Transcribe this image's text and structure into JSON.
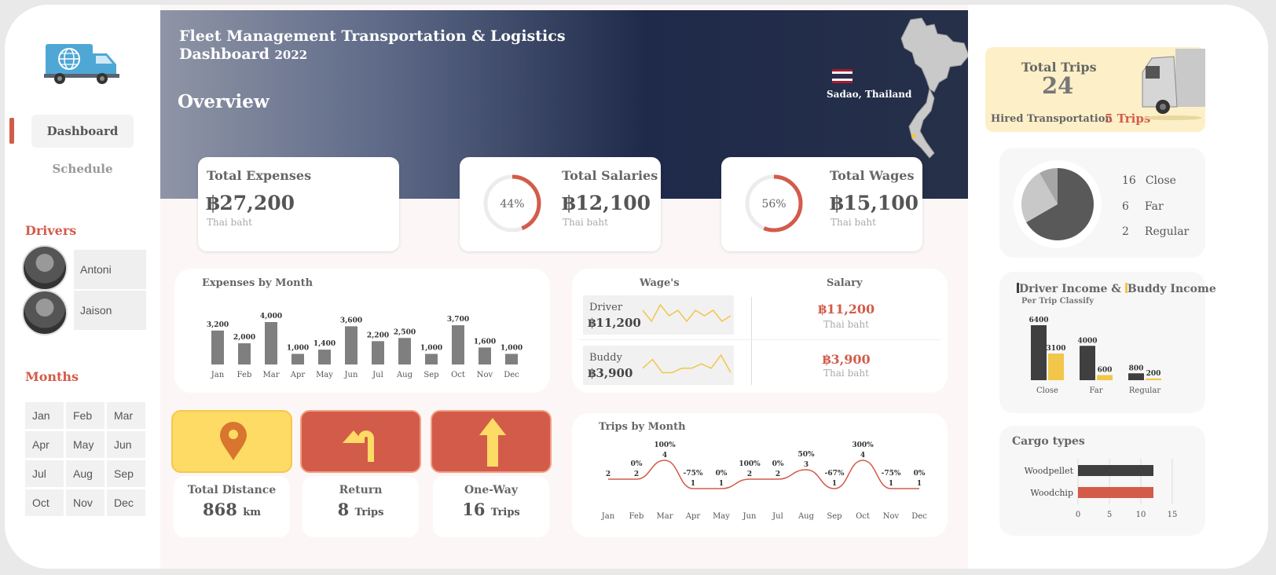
{
  "sidebar": {
    "nav": [
      {
        "label": "Dashboard"
      },
      {
        "label": "Schedule"
      }
    ],
    "drivers_title": "Drivers",
    "drivers": [
      {
        "name": "Antoni"
      },
      {
        "name": "Jaison"
      }
    ],
    "months_title": "Months",
    "months": [
      "Jan",
      "Feb",
      "Mar",
      "Apr",
      "May",
      "Jun",
      "Jul",
      "Aug",
      "Sep",
      "Oct",
      "Nov",
      "Dec"
    ]
  },
  "header": {
    "title_line1": "Fleet Management Transportation & Logistics",
    "title_line2": "Dashboard",
    "year": "2022",
    "overview": "Overview",
    "location": "Sadao, Thailand"
  },
  "kpis": {
    "expenses": {
      "label": "Total Expenses",
      "value": "฿27,200",
      "unit": "Thai baht"
    },
    "salaries": {
      "label": "Total Salaries",
      "value": "฿12,100",
      "unit": "Thai baht",
      "pct_label": "44%",
      "pct": 0.44
    },
    "wages": {
      "label": "Total Wages",
      "value": "฿15,100",
      "unit": "Thai baht",
      "pct_label": "56%",
      "pct": 0.56
    }
  },
  "tiles": {
    "distance": {
      "label": "Total Distance",
      "value": "868",
      "unit": "km"
    },
    "return": {
      "label": "Return",
      "value": "8",
      "unit": "Trips"
    },
    "oneway": {
      "label": "One-Way",
      "value": "16",
      "unit": "Trips"
    }
  },
  "wage_panel": {
    "wages_title": "Wage's",
    "salary_title": "Salary",
    "rows": [
      {
        "name": "Driver",
        "value": "฿11,200",
        "salary": "฿11,200",
        "salary_unit": "Thai baht",
        "spark": [
          3,
          1,
          4,
          2,
          3,
          1,
          3,
          2,
          3,
          1,
          2
        ]
      },
      {
        "name": "Buddy",
        "value": "฿3,900",
        "salary": "฿3,900",
        "salary_unit": "Thai baht",
        "spark": [
          2,
          4,
          1,
          1,
          2,
          2,
          3,
          2,
          5,
          1
        ]
      }
    ]
  },
  "right": {
    "total_trips_label": "Total Trips",
    "total_trips_value": "24",
    "hired_label": "Hired  Transportation",
    "hired_value": "5 Trips",
    "distance_legend": [
      {
        "count": "16",
        "label": "Close",
        "value": 16
      },
      {
        "count": "6",
        "label": "Far",
        "value": 6
      },
      {
        "count": "2",
        "label": "Regular",
        "value": 2
      }
    ],
    "income_title_a": "Driver Income &",
    "income_title_b": "Buddy Income",
    "income_subtitle": "Per Trip Classify",
    "cargo_title": "Cargo types"
  },
  "colors": {
    "accent_red": "#d35b4a",
    "accent_yellow": "#f1c64a",
    "bar_gray": "#7f7f7f",
    "dark_bar": "#3f3f3f",
    "trips_card_bg": "#fdefc7"
  },
  "chart_data": [
    {
      "type": "bar",
      "title": "Expenses by Month",
      "categories": [
        "Jan",
        "Feb",
        "Mar",
        "Apr",
        "May",
        "Jun",
        "Jul",
        "Aug",
        "Sep",
        "Oct",
        "Nov",
        "Dec"
      ],
      "values": [
        3200,
        2000,
        4000,
        1000,
        1400,
        3600,
        2200,
        2500,
        1000,
        3700,
        1600,
        1000
      ],
      "labels": [
        "3,200",
        "2,000",
        "4,000",
        "1,000",
        "1,400",
        "3,600",
        "2,200",
        "2,500",
        "1,000",
        "3,700",
        "1,600",
        "1,000"
      ],
      "ylim": [
        0,
        4000
      ]
    },
    {
      "type": "line",
      "title": "Trips by Month",
      "categories": [
        "Jan",
        "Feb",
        "Mar",
        "Apr",
        "May",
        "Jun",
        "Jul",
        "Aug",
        "Sep",
        "Oct",
        "Nov",
        "Dec"
      ],
      "values": [
        2,
        2,
        4,
        1,
        1,
        2,
        2,
        3,
        1,
        4,
        1,
        1
      ],
      "pct_labels": [
        "",
        "0%",
        "100%",
        "-75%",
        "0%",
        "100%",
        "0%",
        "50%",
        "-67%",
        "300%",
        "-75%",
        "0%"
      ],
      "ylim": [
        0,
        4
      ]
    },
    {
      "type": "pie",
      "categories": [
        "Close",
        "Far",
        "Regular"
      ],
      "values": [
        16,
        6,
        2
      ]
    },
    {
      "type": "bar",
      "categories": [
        "Close",
        "Far",
        "Regular"
      ],
      "series": [
        {
          "name": "Driver Income",
          "values": [
            6400,
            4000,
            800
          ]
        },
        {
          "name": "Buddy Income",
          "values": [
            3100,
            600,
            200
          ]
        }
      ],
      "ylim": [
        0,
        6400
      ]
    },
    {
      "type": "bar",
      "title": "Cargo types",
      "categories": [
        "Woodpellet",
        "Woodchip"
      ],
      "values": [
        12,
        12
      ],
      "xticks": [
        "0",
        "5",
        "10",
        "15"
      ],
      "xlim": [
        0,
        15
      ]
    }
  ]
}
